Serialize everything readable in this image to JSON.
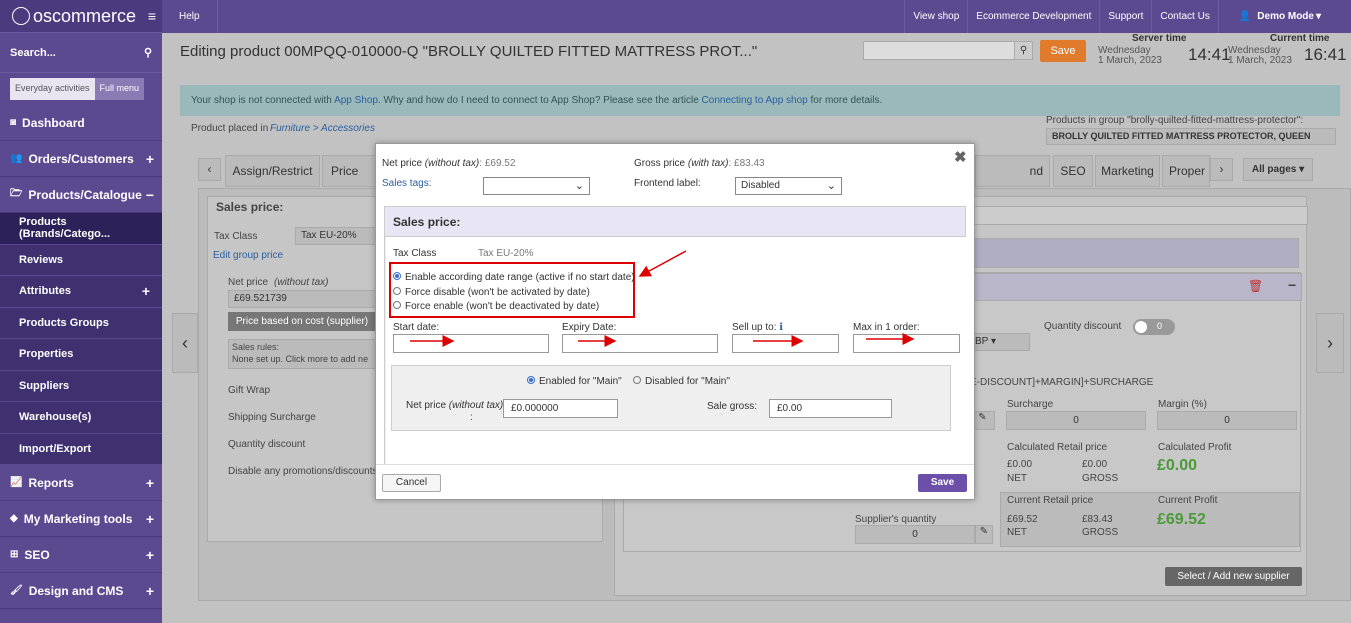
{
  "sidebar": {
    "brand": "oscommerce",
    "search_label": "Search...",
    "mode_everyday": "Everyday activities",
    "mode_full": "Full menu",
    "items": [
      {
        "label": "Dashboard",
        "icon": "dashboard-icon",
        "plus": ""
      },
      {
        "label": "Orders/Customers",
        "icon": "users-icon",
        "plus": "+"
      },
      {
        "label": "Products/Catalogue",
        "icon": "folder-icon",
        "plus": "−"
      }
    ],
    "subitems": [
      {
        "label": "Products (Brands/Catego...",
        "plus": ""
      },
      {
        "label": "Reviews",
        "plus": ""
      },
      {
        "label": "Attributes",
        "plus": "+"
      },
      {
        "label": "Products Groups",
        "plus": ""
      },
      {
        "label": "Properties",
        "plus": ""
      },
      {
        "label": "Suppliers",
        "plus": ""
      },
      {
        "label": "Warehouse(s)",
        "plus": ""
      },
      {
        "label": "Import/Export",
        "plus": ""
      }
    ],
    "items2": [
      {
        "label": "Reports",
        "icon": "chart-icon",
        "plus": "+"
      },
      {
        "label": "My Marketing tools",
        "icon": "tag-icon",
        "plus": "+"
      },
      {
        "label": "SEO",
        "icon": "sitemap-icon",
        "plus": "+"
      },
      {
        "label": "Design and CMS",
        "icon": "brush-icon",
        "plus": "+"
      }
    ]
  },
  "topbar": {
    "help": "Help",
    "links": [
      "View shop",
      "Ecommerce Development",
      "Support",
      "Contact Us"
    ],
    "user": "Demo Mode"
  },
  "header": {
    "title": "Editing product 00MPQQ-010000-Q \"BROLLY QUILTED FITTED MATTRESS PROT...\"",
    "save": "Save",
    "server_time_label": "Server time",
    "server_day": "Wednesday",
    "server_date": "1 March, 2023",
    "server_time": "14:41",
    "current_time_label": "Current time",
    "current_day": "Wednesday",
    "current_date": "1 March, 2023",
    "current_time": "16:41"
  },
  "notice": {
    "pre": "Your shop is not connected with ",
    "link1": "App Shop",
    "mid": ". Why and how do I need to connect to App Shop? Please see the article ",
    "link2": "Connecting to App shop",
    "post": " for more details."
  },
  "background": {
    "placed_in": "Product placed in",
    "category": "Furniture > Accessories",
    "group_label": "Products in group \"brolly-quilted-fitted-mattress-protector\":",
    "group_value": "BROLLY QUILTED FITTED MATTRESS PROTECTOR, QUEEN",
    "tabs": [
      "Assign/Restrict",
      "Price and",
      "nd Packaging",
      "SEO",
      "Marketing",
      "Proper"
    ],
    "all_pages": "All pages",
    "sales_price": "Sales price:",
    "tax_class": "Tax Class",
    "tax_value": "Tax EU-20%",
    "edit_group_price": "Edit group price",
    "net_price_label": "Net price",
    "net_price_note": "(without tax)",
    "net_price_value": "£69.521739",
    "price_cost_btn": "Price based on cost (supplier)",
    "sales_rules": "Sales rules:",
    "sales_rules_note": "None set up. Click more to add ne",
    "gift_wrap": "Gift Wrap",
    "shipping_surcharge": "Shipping Surcharge",
    "quantity_discount": "Quantity discount",
    "disable_promos": "Disable any promotions/discounts",
    "quantity_discount_r": "Quantity discount",
    "currency_frag": "BP",
    "formula": "E-DISCOUNT]+MARGIN]+SURCHARGE",
    "surcharge": "Surcharge",
    "margin": "Margin (%)",
    "zero": "0",
    "calc_retail": "Calculated Retail price",
    "calc_profit": "Calculated Profit",
    "calc_net": "£0.00",
    "calc_gross": "£0.00",
    "net": "NET",
    "gross": "GROSS",
    "calc_profit_value": "£0.00",
    "cur_retail": "Current Retail price",
    "cur_profit": "Current Profit",
    "cur_net": "£69.52",
    "cur_gross": "£83.43",
    "cur_profit_value": "£69.52",
    "supplier_qty": "Supplier's quantity",
    "supplier_qty_value": "0",
    "select_supplier": "Select / Add new supplier"
  },
  "modal": {
    "net_label": "Net price",
    "net_note": "(without tax)",
    "net_value": ": £69.52",
    "gross_label": "Gross price",
    "gross_note": "(with tax)",
    "gross_value": ": £83.43",
    "sales_tags": "Sales tags:",
    "frontend_label": "Frontend label:",
    "frontend_value": "Disabled",
    "panel_title": "Sales price:",
    "tax_class": "Tax Class",
    "tax_value": "Tax EU-20%",
    "radio1": "Enable according date range (active if no start date)",
    "radio2": "Force disable (won't be activated by date)",
    "radio3": "Force enable (won't be deactivated by date)",
    "start_date": "Start date:",
    "expiry_date": "Expiry Date:",
    "sell_up_to": "Sell up to:",
    "max_in_order": "Max in 1 order:",
    "enabled_main": "Enabled for \"Main\"",
    "disabled_main": "Disabled for \"Main\"",
    "net_price_without": "Net price",
    "net_price_without_note": "(without tax)",
    "net_price_value": "£0.000000",
    "sale_gross": "Sale gross:",
    "sale_gross_value": "£0.00",
    "cancel": "Cancel",
    "save": "Save"
  },
  "colors": {
    "sidebar": "#5c4a91",
    "save_orange": "#e07b2c",
    "save_purple": "#6b4fa8",
    "profit_green": "#4a9a3a",
    "annotation_red": "#dd0000"
  }
}
